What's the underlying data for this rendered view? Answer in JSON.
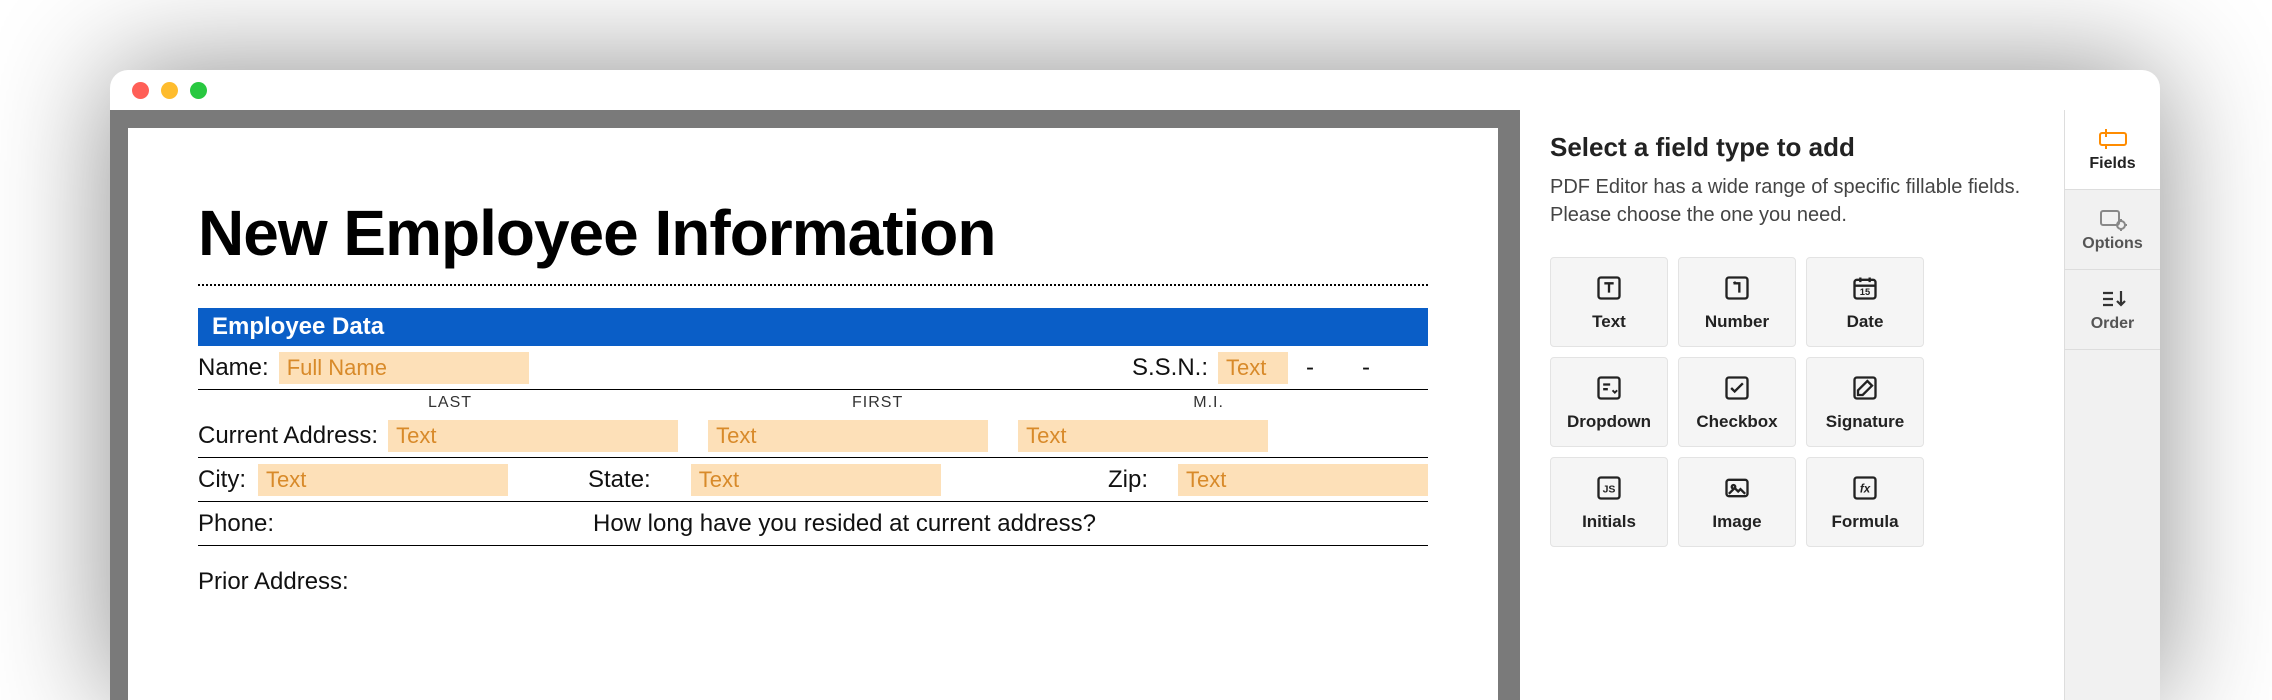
{
  "doc": {
    "title": "New Employee Information",
    "section": "Employee Data",
    "labels": {
      "name": "Name:",
      "ssn": "S.S.N.:",
      "last": "LAST",
      "first": "FIRST",
      "mi": "M.I.",
      "currentAddress": "Current Address:",
      "city": "City:",
      "state": "State:",
      "zip": "Zip:",
      "phone": "Phone:",
      "howLong": "How long have you resided at current address?",
      "priorAddress": "Prior Address:"
    },
    "fields": {
      "fullName": "Full Name",
      "ssn": "Text",
      "addr1": "Text",
      "addr2": "Text",
      "addr3": "Text",
      "city": "Text",
      "state": "Text",
      "zip": "Text"
    },
    "ssnSep1": "-",
    "ssnSep2": "-"
  },
  "panel": {
    "title": "Select a field type to add",
    "desc": "PDF Editor has a wide range of specific fillable fields. Please choose the one you need.",
    "fields": {
      "text": "Text",
      "number": "Number",
      "date": "Date",
      "dropdown": "Dropdown",
      "checkbox": "Checkbox",
      "signature": "Signature",
      "initials": "Initials",
      "image": "Image",
      "formula": "Formula"
    }
  },
  "tabs": {
    "fields": "Fields",
    "options": "Options",
    "order": "Order"
  }
}
